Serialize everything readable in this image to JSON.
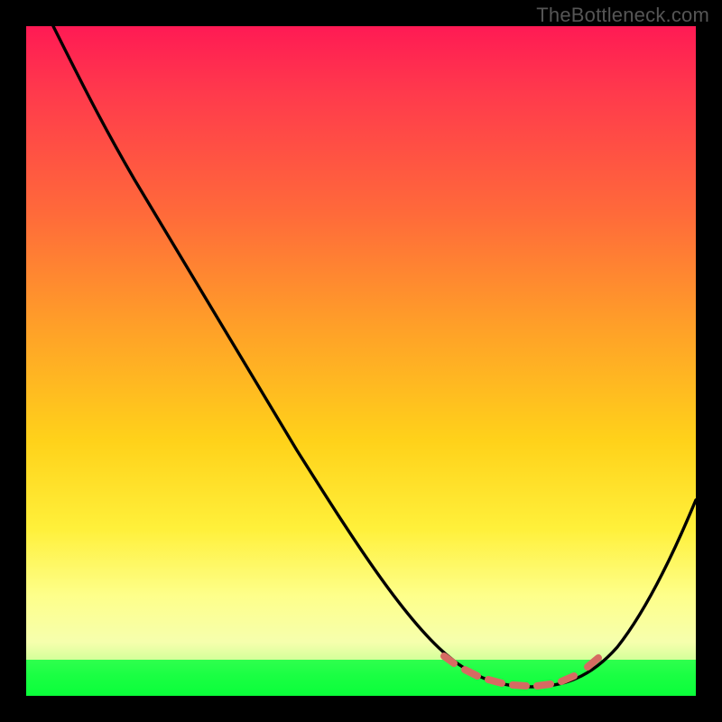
{
  "watermark": "TheBottleneck.com",
  "chart_data": {
    "type": "line",
    "title": "",
    "xlabel": "",
    "ylabel": "",
    "xlim": [
      0,
      100
    ],
    "ylim": [
      0,
      100
    ],
    "grid": false,
    "legend": false,
    "series": [
      {
        "name": "bottleneck-curve",
        "x": [
          4,
          10,
          20,
          30,
          40,
          50,
          58,
          62,
          65,
          70,
          75,
          80,
          84,
          88,
          92,
          96,
          100
        ],
        "values": [
          100,
          92,
          78,
          63,
          48,
          33,
          21,
          14,
          9,
          4,
          2,
          2,
          4,
          9,
          17,
          27,
          38
        ]
      }
    ],
    "optimal_range_x": [
      63,
      85
    ],
    "markers": {
      "type": "dashed-segments",
      "color": "#d66b62",
      "x_range": [
        63,
        85
      ],
      "approx_y": 3
    },
    "gradient_stops": [
      {
        "pos": 0,
        "color": "#ff1a54"
      },
      {
        "pos": 0.28,
        "color": "#ff6a3a"
      },
      {
        "pos": 0.62,
        "color": "#ffd21a"
      },
      {
        "pos": 0.85,
        "color": "#feff8a"
      },
      {
        "pos": 0.946,
        "color": "#2fff4e"
      },
      {
        "pos": 1.0,
        "color": "#0aff3a"
      }
    ]
  }
}
